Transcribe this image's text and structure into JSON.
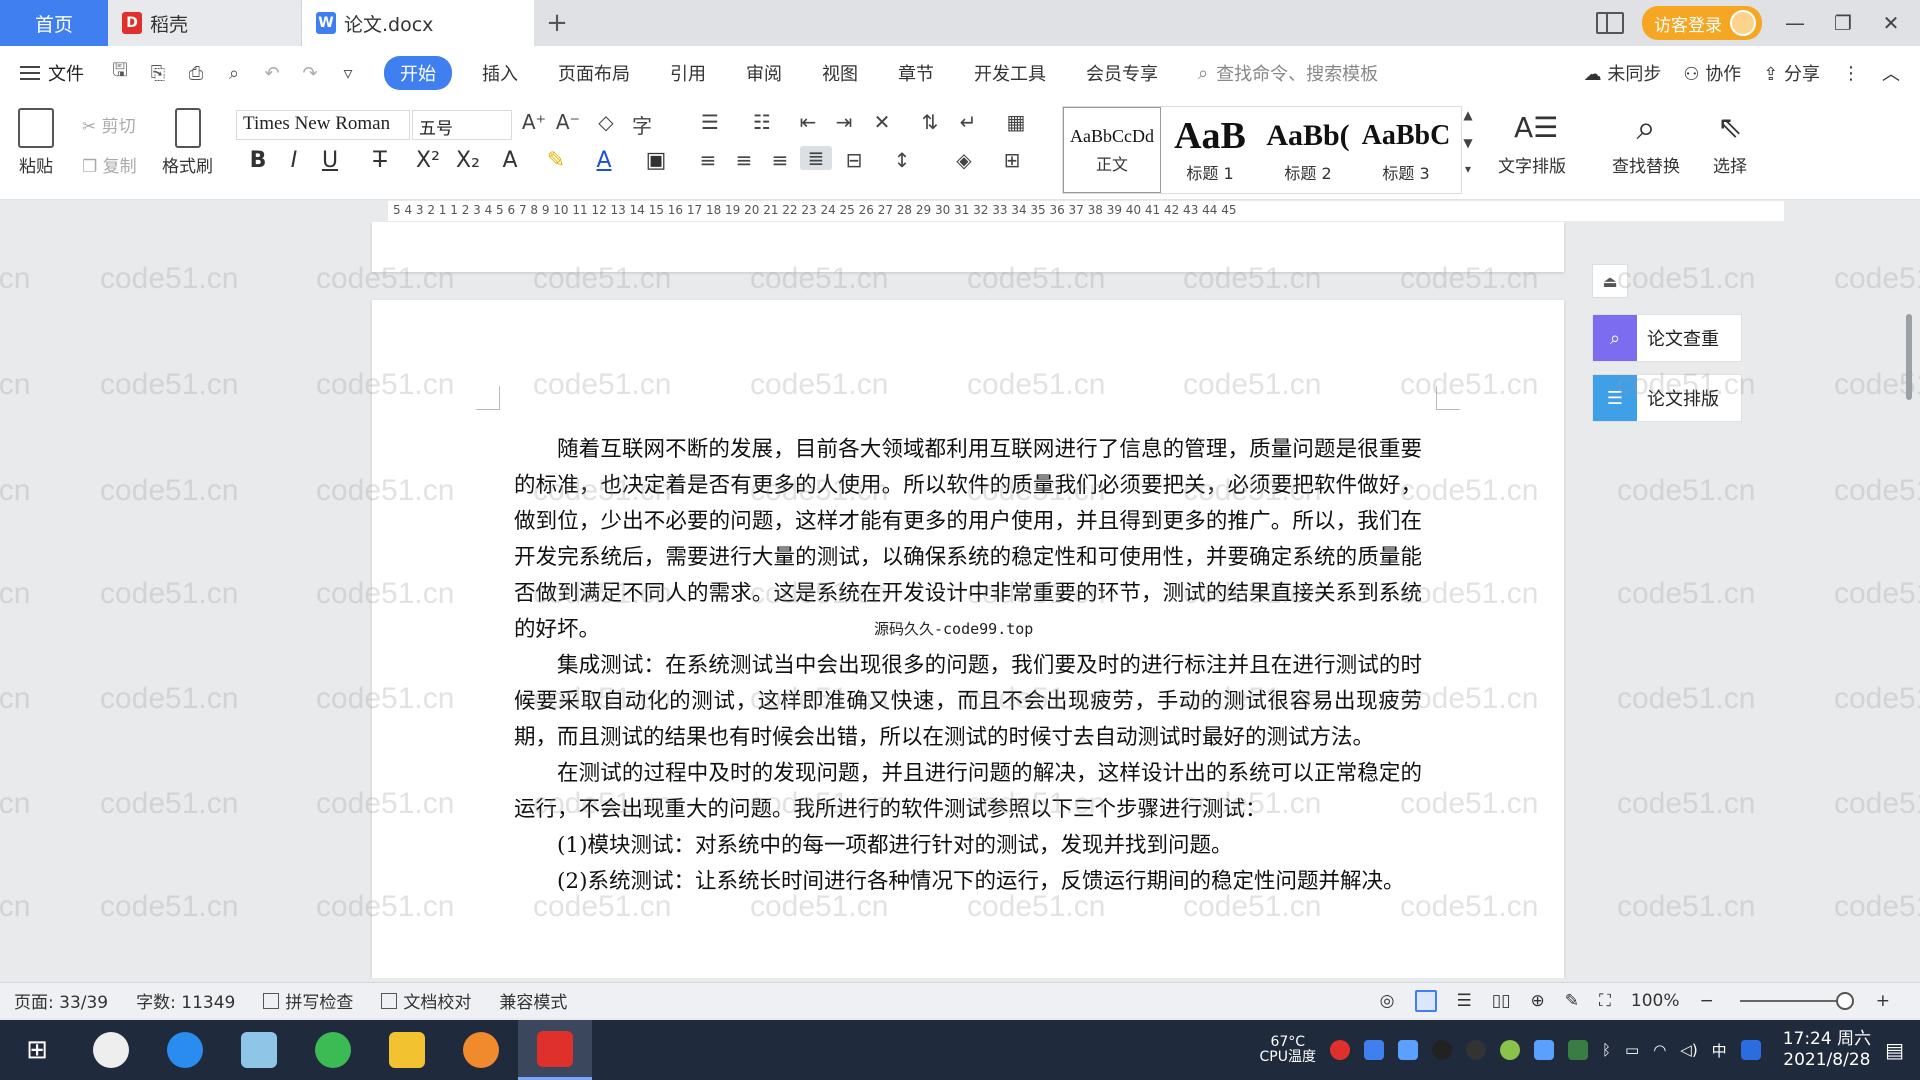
{
  "tabs": {
    "home": "首页",
    "daoke": "稻壳",
    "doc": "论文.docx",
    "add": "+",
    "login": "访客登录"
  },
  "menu": {
    "file": "文件",
    "items": [
      "开始",
      "插入",
      "页面布局",
      "引用",
      "审阅",
      "视图",
      "章节",
      "开发工具",
      "会员专享"
    ],
    "search": "查找命令、搜索模板",
    "unsynced": "未同步",
    "collab": "协作",
    "share": "分享"
  },
  "ribbon": {
    "paste": "粘贴",
    "cut": "剪切",
    "copy": "复制",
    "format_painter": "格式刷",
    "font_name": "Times New Roman",
    "font_size": "五号",
    "styles": [
      {
        "preview": "AaBbCcDd",
        "label": "正文"
      },
      {
        "preview": "AaB",
        "label": "标题 1"
      },
      {
        "preview": "AaBb(",
        "label": "标题 2"
      },
      {
        "preview": "AaBbC",
        "label": "标题 3"
      }
    ],
    "text_layout": "文字排版",
    "find_replace": "查找替换",
    "select": "选择"
  },
  "ruler": {
    "numbers": "5 4 3 2 1 1 2 3 4 5 6 7 8 9 10 11 12 13 14 15 16 17 18 19 20 21 22 23 24 25 26 27 28 29 30 31 32 33 34 35 36 37 38 39 40 41 42 43 44 45"
  },
  "document": {
    "overlay_text": "源码久久-code99.top",
    "paragraphs": [
      "随着互联网不断的发展，目前各大领域都利用互联网进行了信息的管理，质量问题是很重要的标准，也决定着是否有更多的人使用。所以软件的质量我们必须要把关，必须要把软件做好，做到位，少出不必要的问题，这样才能有更多的用户使用，并且得到更多的推广。所以，我们在开发完系统后，需要进行大量的测试，以确保系统的稳定性和可使用性，并要确定系统的质量能否做到满足不同人的需求。这是系统在开发设计中非常重要的环节，测试的结果直接关系到系统的好坏。",
      "集成测试：在系统测试当中会出现很多的问题，我们要及时的进行标注并且在进行测试的时候要采取自动化的测试，这样即准确又快速，而且不会出现疲劳，手动的测试很容易出现疲劳期，而且测试的结果也有时候会出错，所以在测试的时候寸去自动测试时最好的测试方法。",
      "在测试的过程中及时的发现问题，并且进行问题的解决，这样设计出的系统可以正常稳定的运行，不会出现重大的问题。我所进行的软件测试参照以下三个步骤进行测试：",
      "(1)模块测试：对系统中的每一项都进行针对的测试，发现并找到问题。",
      "(2)系统测试：让系统长时间进行各种情况下的运行，反馈运行期间的稳定性问题并解决。"
    ],
    "watermark": "code51.cn"
  },
  "side_panel": {
    "check": "论文查重",
    "layout": "论文排版"
  },
  "status": {
    "page": "页面: 33/39",
    "words": "字数: 11349",
    "spell": "拼写检查",
    "proof": "文档校对",
    "compat": "兼容模式",
    "zoom": "100%"
  },
  "taskbar": {
    "temp": "67°C",
    "cpu_label": "CPU温度",
    "ime": "中",
    "time": "17:24 周六",
    "date": "2021/8/28"
  },
  "colors": {
    "accent": "#3f7ff0",
    "login": "#f5a623",
    "taskbar": "#1f2a3d",
    "wps_red": "#e0302c"
  }
}
